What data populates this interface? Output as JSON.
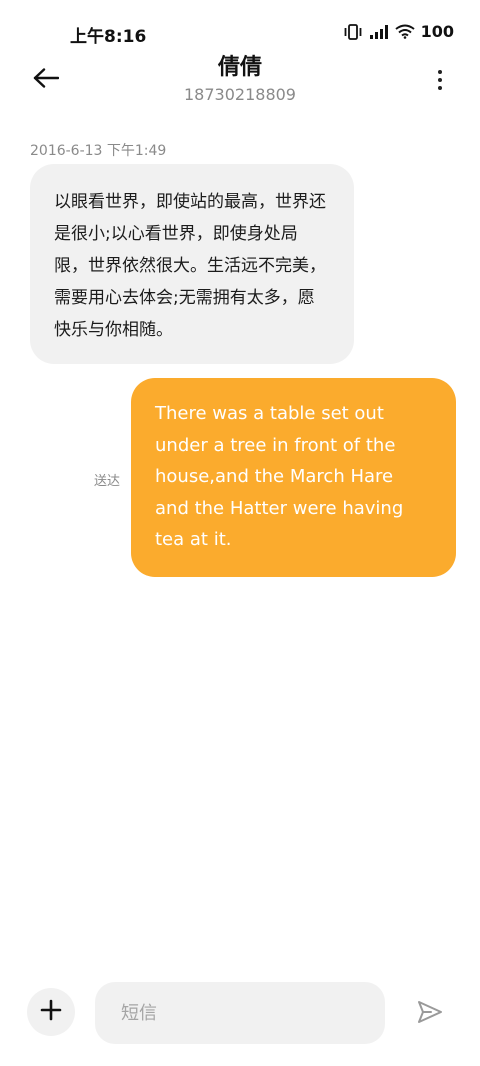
{
  "status_bar": {
    "time": "上午8:16",
    "battery": "100"
  },
  "header": {
    "contact_name": "倩倩",
    "contact_number": "18730218809",
    "back_icon": "back-arrow-icon",
    "more_icon": "more-vertical-icon"
  },
  "conversation": {
    "timestamp": "2016-6-13 下午1:49",
    "incoming_message": "以眼看世界，即使站的最高，世界还是很小;以心看世界，即使身处局限，世界依然很大。生活远不完美，需要用心去体会;无需拥有太多，愿快乐与你相随。",
    "outgoing_message": "There was a table set out under a tree in front of the house,and the March Hare and the Hatter were having tea at it.",
    "delivery_status": "送达"
  },
  "composer": {
    "placeholder": "短信",
    "value": "",
    "add_icon": "plus-icon",
    "send_icon": "send-icon"
  },
  "colors": {
    "outgoing_bubble": "#fbab2d",
    "incoming_bubble": "#f1f1f1",
    "secondary_text": "#8a8a8a"
  }
}
